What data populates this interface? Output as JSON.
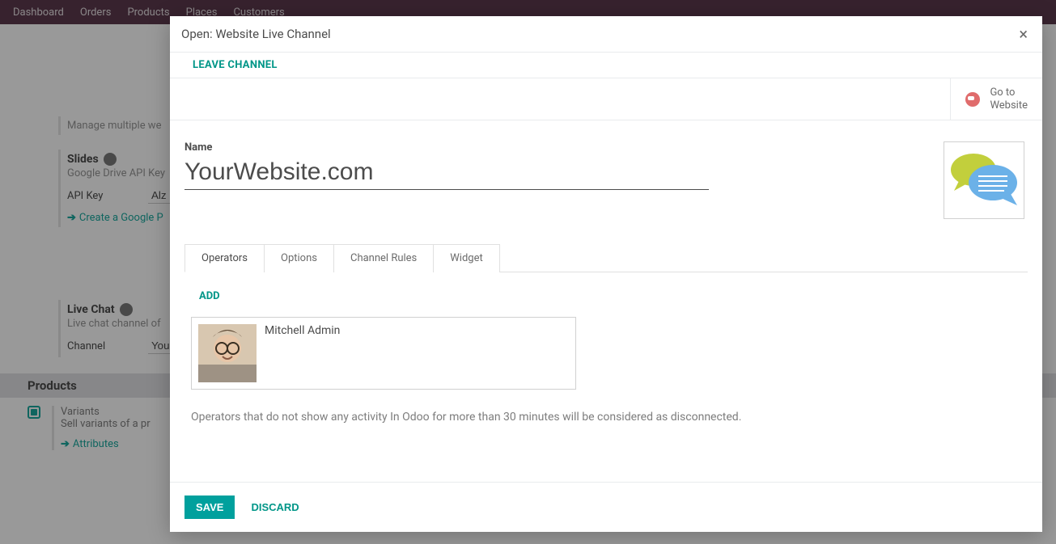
{
  "navbar": {
    "items": [
      "Dashboard",
      "Orders",
      "Products",
      "Places",
      "Customers"
    ]
  },
  "background": {
    "top_desc": "Manage multiple we",
    "slides_title": "Slides",
    "slides_desc": "Google Drive API Key",
    "api_key_label": "API Key",
    "api_key_value": "Alz",
    "create_project_link": "Create a Google P",
    "livechat_title": "Live Chat",
    "livechat_desc": "Live chat channel of",
    "channel_label": "Channel",
    "channel_value": "You",
    "products_header": "Products",
    "variants_title": "Variants",
    "variants_desc": "Sell variants of a pr",
    "attributes_link": "Attributes"
  },
  "modal": {
    "title": "Open: Website Live Channel",
    "leave_label": "LEAVE CHANNEL",
    "go_website_line1": "Go to",
    "go_website_line2": "Website",
    "name_label": "Name",
    "name_value": "YourWebsite.com",
    "tabs": [
      "Operators",
      "Options",
      "Channel Rules",
      "Widget"
    ],
    "add_label": "ADD",
    "operator_name": "Mitchell Admin",
    "helper": "Operators that do not show any activity In Odoo for more than 30 minutes will be considered as disconnected.",
    "save_label": "SAVE",
    "discard_label": "DISCARD"
  }
}
